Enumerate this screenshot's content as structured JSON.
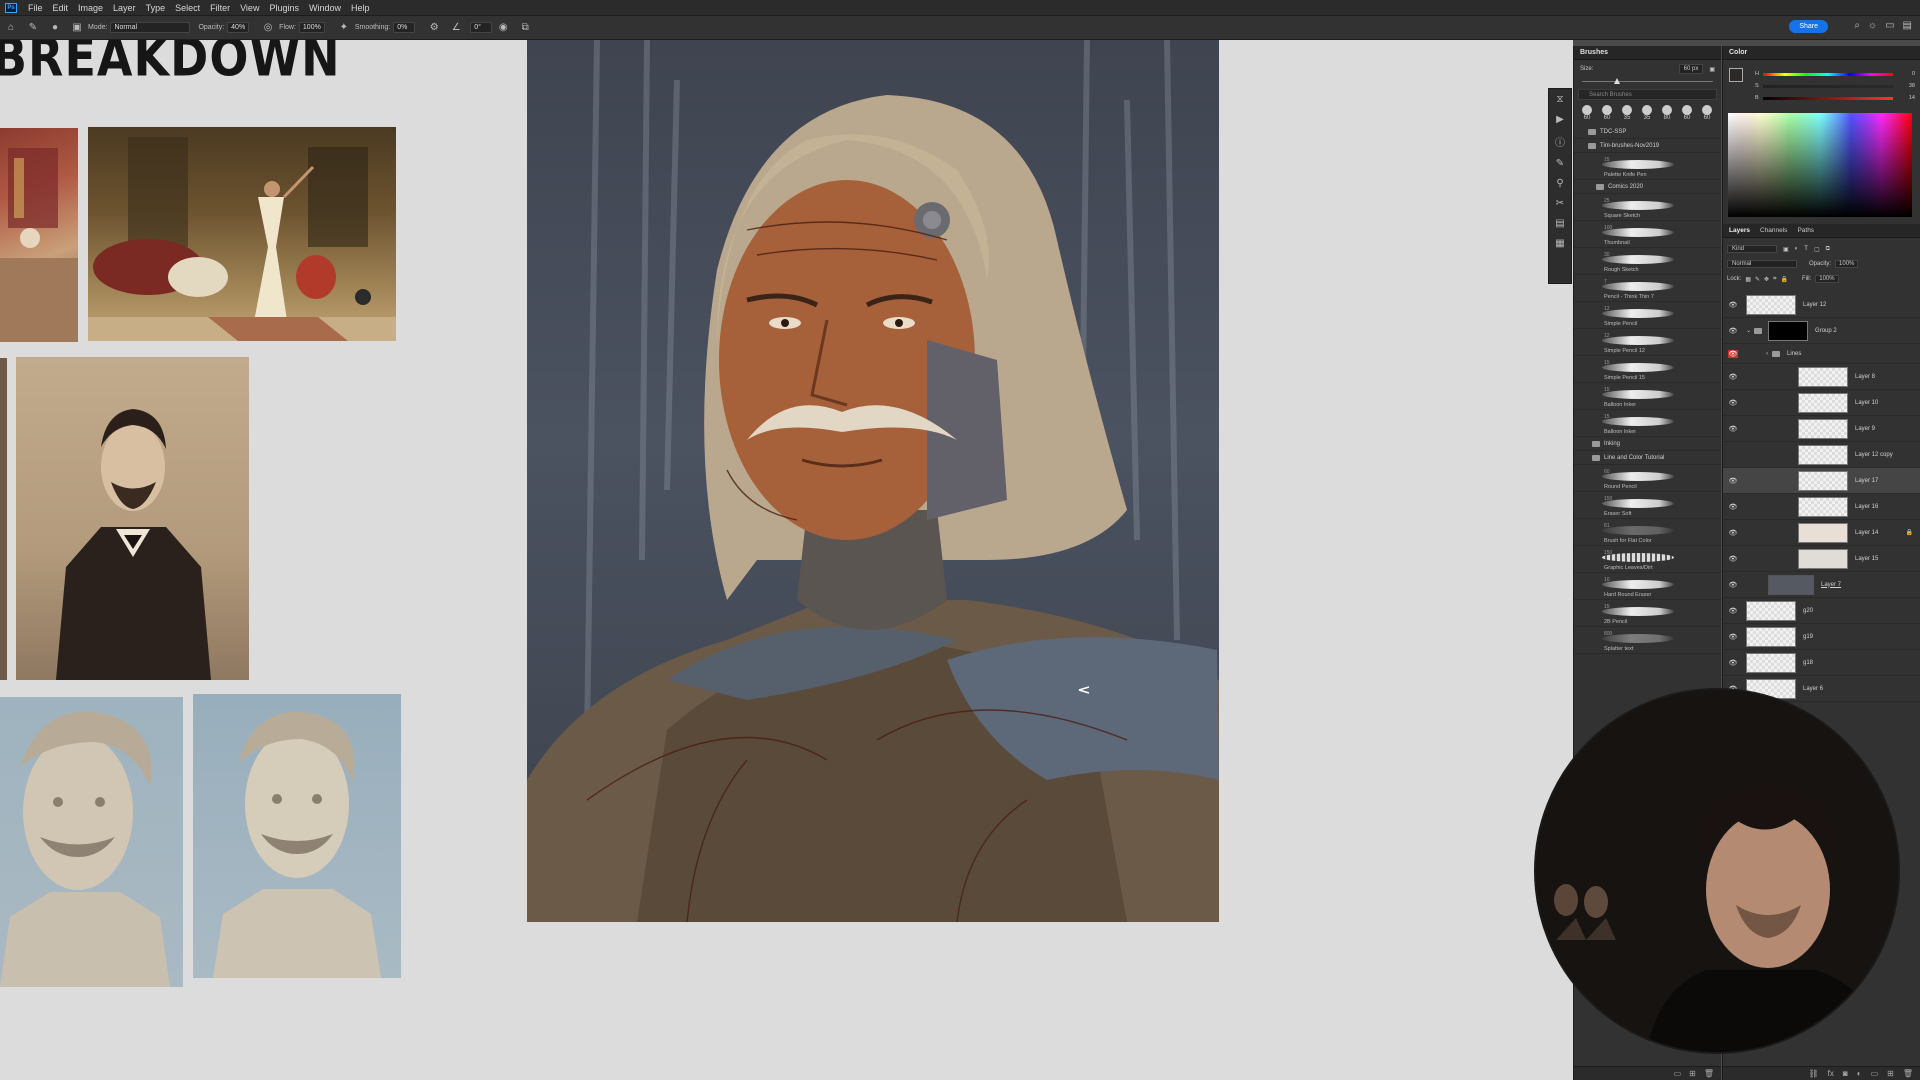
{
  "menubar": {
    "items": [
      "File",
      "Edit",
      "Image",
      "Layer",
      "Type",
      "Select",
      "Filter",
      "View",
      "Plugins",
      "Window",
      "Help"
    ]
  },
  "options": {
    "mode_label": "Mode:",
    "mode_value": "Normal",
    "opacity_label": "Opacity:",
    "opacity_value": "40%",
    "flow_label": "Flow:",
    "flow_value": "100%",
    "smoothing_label": "Smoothing:",
    "smoothing_value": "0%",
    "angle_value": "0°",
    "share_label": "Share"
  },
  "board": {
    "title": "BREAKDOWN"
  },
  "brushes": {
    "tab": "Brushes",
    "size_label": "Size:",
    "size_value": "60 px",
    "search_placeholder": "Search Brushes",
    "preset_sizes": [
      "60",
      "60",
      "35",
      "35",
      "80",
      "60",
      "60"
    ],
    "folder1": "TDC-SSP",
    "folder2": "Tim-brushes-Nov2019",
    "folder3": "Comics 2020",
    "folder4": "Inking",
    "folder5": "Line and Color Tutorial",
    "items": [
      {
        "size": "15",
        "name": "Palette Knife Pen"
      },
      {
        "size": "25",
        "name": "Square Sketch"
      },
      {
        "size": "100",
        "name": "Thumbnail"
      },
      {
        "size": "30",
        "name": "Rough Sketch"
      },
      {
        "size": "7",
        "name": "Pencil - Think Thin 7"
      },
      {
        "size": "12",
        "name": "Simple Pencil"
      },
      {
        "size": "12",
        "name": "Simple Pencil 12"
      },
      {
        "size": "15",
        "name": "Simple Pencil 15"
      },
      {
        "size": "15",
        "name": "Balloon Inker"
      },
      {
        "size": "15",
        "name": "Balloon Inker"
      },
      {
        "size": "60",
        "name": "Round Pencil"
      },
      {
        "size": "150",
        "name": "Eraser Soft"
      },
      {
        "size": "81",
        "name": "Brush for Flat Color"
      },
      {
        "size": "150",
        "name": "Graphic Leaves/Dirt"
      },
      {
        "size": "10",
        "name": "Hard Round Eraser"
      },
      {
        "size": "15",
        "name": "2B Pencil"
      },
      {
        "size": "800",
        "name": "Splatter text"
      }
    ]
  },
  "color_panel": {
    "tab": "Color",
    "h_label": "H",
    "h_value": "0",
    "s_label": "S",
    "s_value": "38",
    "b_label": "B",
    "b_value": "14",
    "fg_color": "#2b2a29",
    "bg_color": "#ffffff"
  },
  "layers_panel": {
    "tabs": [
      "Layers",
      "Channels",
      "Paths"
    ],
    "kind_label": "Kind",
    "blend_mode": "Normal",
    "opacity_label": "Opacity:",
    "opacity_value": "100%",
    "lock_label": "Lock:",
    "fill_label": "Fill:",
    "fill_value": "100%",
    "layers": [
      {
        "name": "Layer 12",
        "visible": true
      },
      {
        "name": "Group 2",
        "visible": true
      },
      {
        "name": "Lines",
        "visible": true
      },
      {
        "name": "Layer 8",
        "visible": true
      },
      {
        "name": "Layer 10",
        "visible": true
      },
      {
        "name": "Layer 9",
        "visible": true
      },
      {
        "name": "Layer 12 copy",
        "visible": false
      },
      {
        "name": "Layer 17",
        "visible": true
      },
      {
        "name": "Layer 16",
        "visible": true
      },
      {
        "name": "Layer 14",
        "visible": true
      },
      {
        "name": "Layer 15",
        "visible": true
      },
      {
        "name": "Layer 7",
        "visible": true
      },
      {
        "name": "g20",
        "visible": true
      },
      {
        "name": "g19",
        "visible": true
      },
      {
        "name": "g18",
        "visible": true
      },
      {
        "name": "Layer 6",
        "visible": true
      }
    ]
  }
}
